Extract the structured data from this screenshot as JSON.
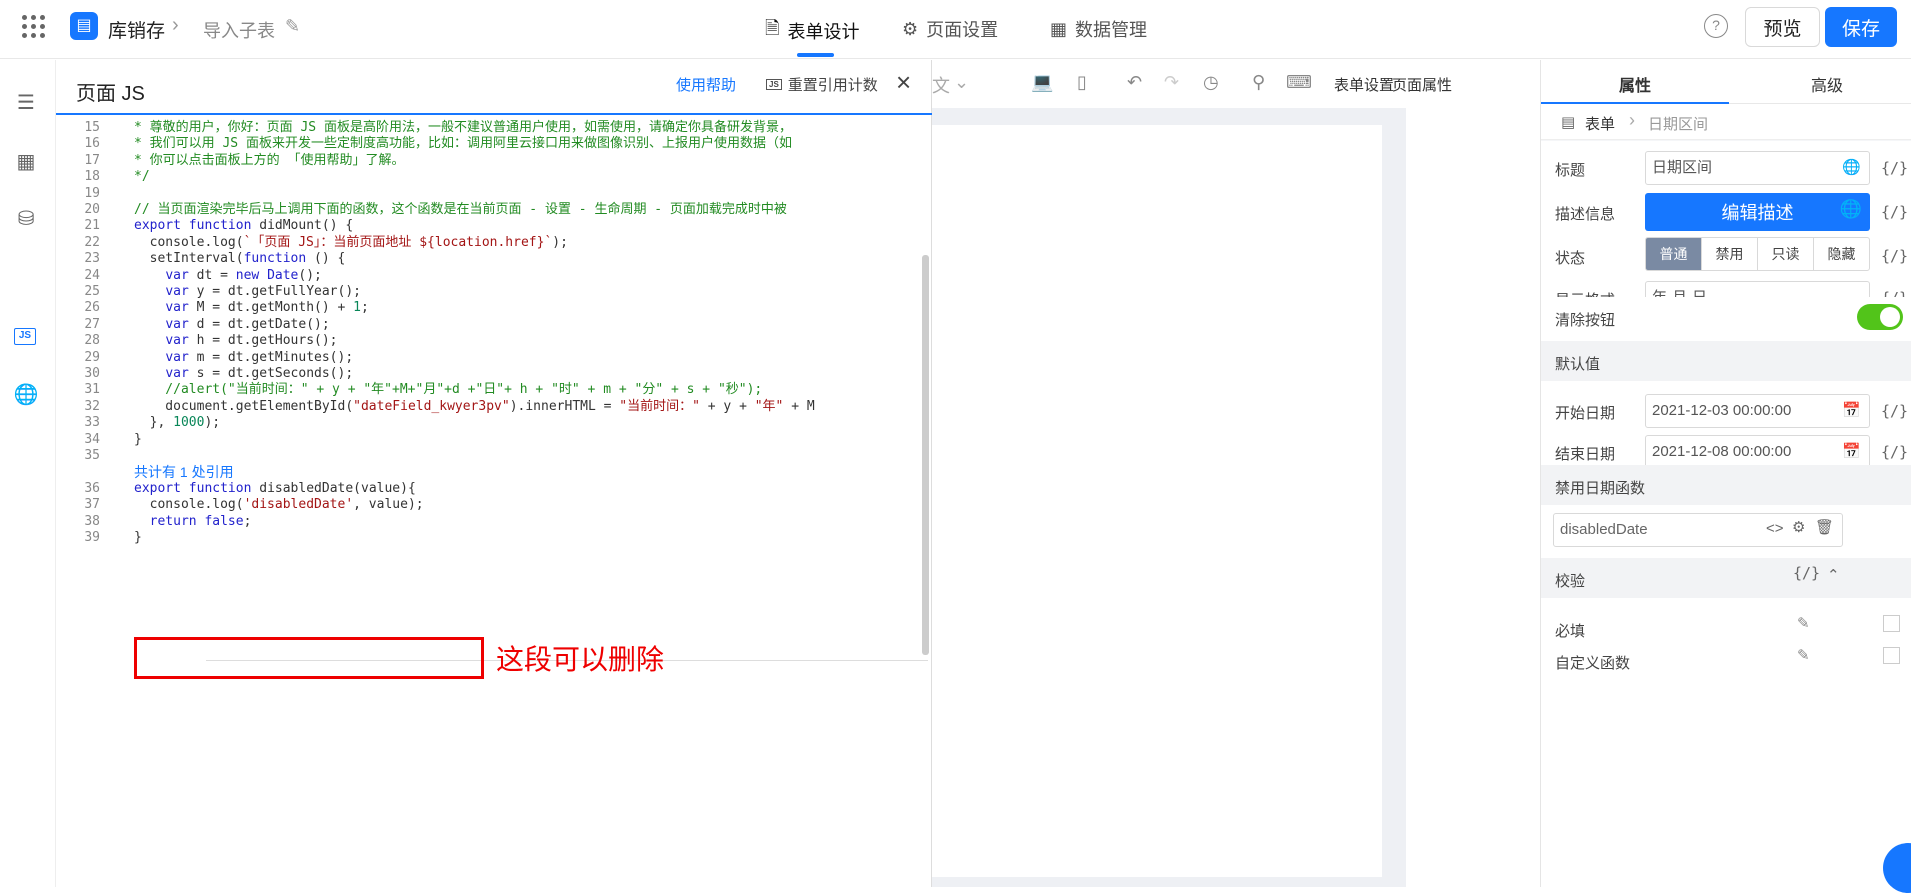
{
  "topbar": {
    "app_name": "库销存",
    "page_name": "导入子表",
    "tabs": [
      {
        "label": "表单设计",
        "icon": "document-icon"
      },
      {
        "label": "页面设置",
        "icon": "gear-icon"
      },
      {
        "label": "数据管理",
        "icon": "table-icon"
      }
    ],
    "preview_label": "预览",
    "save_label": "保存"
  },
  "js_panel": {
    "title": "页面 JS",
    "help_link": "使用帮助",
    "reset_label": "重置引用计数",
    "js_badge": "JS",
    "ref_count_text": "共计有 1 处引用",
    "annotation": "这段可以删除",
    "lines": [
      {
        "n": "15",
        "text": "* 尊敬的用户，你好：页面 JS 面板是高阶用法，一般不建议普通用户使用，如需使用，请确定你具备研发背景，"
      },
      {
        "n": "16",
        "text": "* 我们可以用 JS 面板来开发一些定制度高功能，比如：调用阿里云接口用来做图像识别、上报用户使用数据（如"
      },
      {
        "n": "17",
        "text": "* 你可以点击面板上方的 「使用帮助」了解。"
      },
      {
        "n": "18",
        "text": "*/"
      },
      {
        "n": "19",
        "text": ""
      },
      {
        "n": "20",
        "text": "// 当页面渲染完毕后马上调用下面的函数，这个函数是在当前页面 - 设置 - 生命周期 - 页面加载完成时中被"
      },
      {
        "n": "21",
        "text": "export function didMount() {"
      },
      {
        "n": "22",
        "text": "  console.log(`「页面 JS」：当前页面地址 ${location.href}`);"
      },
      {
        "n": "23",
        "text": "  setInterval(function () {"
      },
      {
        "n": "24",
        "text": "    var dt = new Date();"
      },
      {
        "n": "25",
        "text": "    var y = dt.getFullYear();"
      },
      {
        "n": "26",
        "text": "    var M = dt.getMonth() + 1;"
      },
      {
        "n": "27",
        "text": "    var d = dt.getDate();"
      },
      {
        "n": "28",
        "text": "    var h = dt.getHours();"
      },
      {
        "n": "29",
        "text": "    var m = dt.getMinutes();"
      },
      {
        "n": "30",
        "text": "    var s = dt.getSeconds();"
      },
      {
        "n": "31",
        "text": "    //alert(\"当前时间：\" + y + \"年\"+M+\"月\"+d +\"日\"+ h + \"时\" + m + \"分\" + s + \"秒\");"
      },
      {
        "n": "32",
        "text": "    document.getElementById(\"dateField_kwyer3pv\").innerHTML = \"当前时间：\" + y + \"年\" + M"
      },
      {
        "n": "33",
        "text": "  }, 1000);"
      },
      {
        "n": "34",
        "text": "}"
      },
      {
        "n": "35",
        "text": ""
      },
      {
        "n": "36",
        "text": "export function disabledDate(value){"
      },
      {
        "n": "37",
        "text": "  console.log('disabledDate', value);"
      },
      {
        "n": "38",
        "text": "  return false;"
      },
      {
        "n": "39",
        "text": "}"
      }
    ]
  },
  "canvas_toolbar": {
    "form_settings": "表单设置",
    "page_props": "页面属性"
  },
  "props": {
    "tab_props": "属性",
    "tab_advanced": "高级",
    "crumb_root": "表单",
    "crumb_current": "日期区间",
    "fields": {
      "title_label": "标题",
      "title_value": "日期区间",
      "desc_label": "描述信息",
      "desc_button": "编辑描述",
      "state_label": "状态",
      "state_options": [
        "普通",
        "禁用",
        "只读",
        "隐藏"
      ],
      "format_label": "显示格式",
      "format_value": "年-月-日",
      "clear_label": "清除按钮"
    },
    "default_section": "默认值",
    "start_label": "开始日期",
    "start_value": "2021-12-03 00:00:00",
    "end_label": "结束日期",
    "end_value": "2021-12-08 00:00:00",
    "disabled_section": "禁用日期函数",
    "disabled_fn": "disabledDate",
    "validate_section": "校验",
    "required_label": "必填",
    "custom_fn_label": "自定义函数",
    "fx_text": "{/}"
  },
  "colors": {
    "accent": "#1677ff",
    "toggle_on": "#52c41a",
    "annotation": "#ee0000"
  }
}
